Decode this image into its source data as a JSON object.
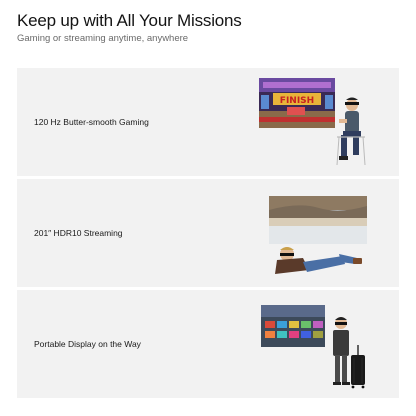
{
  "header": {
    "title": "Keep up with All Your Missions",
    "subtitle": "Gaming or streaming anytime, anywhere"
  },
  "features": [
    {
      "label": "120 Hz Butter-smooth Gaming",
      "image": "racing-game-screen-with-seated-gamer"
    },
    {
      "label": "201″ HDR10 Streaming",
      "image": "landscape-screen-with-reclining-viewer"
    },
    {
      "label": "Portable Display on the Way",
      "image": "app-grid-screen-with-traveler-and-suitcase"
    }
  ]
}
